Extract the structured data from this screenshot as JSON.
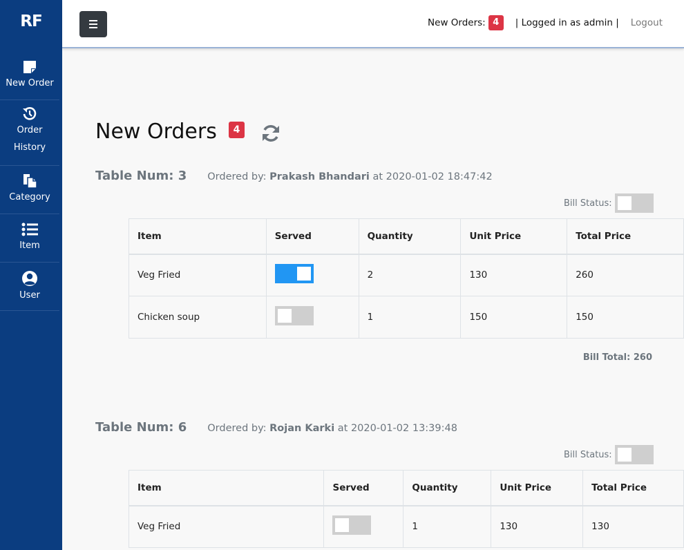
{
  "sidebar": {
    "logo": "RF",
    "items": [
      {
        "label": "New Order",
        "icon": "sticky-note-icon"
      },
      {
        "label": "Order History",
        "label_line1": "Order",
        "label_line2": "History",
        "icon": "history-icon"
      },
      {
        "label": "Category",
        "icon": "copy-icon"
      },
      {
        "label": "Item",
        "icon": "list-icon"
      },
      {
        "label": "User",
        "icon": "user-circle-icon"
      }
    ]
  },
  "topbar": {
    "new_orders_label": "New Orders:",
    "new_orders_count": "4",
    "logged_in": "| Logged in as admin |",
    "logout": "Logout"
  },
  "main": {
    "title": "New Orders",
    "count": "4"
  },
  "orders": [
    {
      "table_num": "Table Num: 3",
      "ordered_by_label": "Ordered by:",
      "customer": "Prakash Bhandari",
      "at_text": "at 2020-01-02 18:47:42",
      "bill_status_label": "Bill Status:",
      "bill_status_on": false,
      "columns": [
        "Item",
        "Served",
        "Quantity",
        "Unit Price",
        "Total Price"
      ],
      "rows": [
        {
          "item": "Veg Fried",
          "served": true,
          "quantity": "2",
          "unit_price": "130",
          "total_price": "260"
        },
        {
          "item": "Chicken soup",
          "served": false,
          "quantity": "1",
          "unit_price": "150",
          "total_price": "150"
        }
      ],
      "bill_total": "Bill Total: 260"
    },
    {
      "table_num": "Table Num: 6",
      "ordered_by_label": "Ordered by:",
      "customer": "Rojan Karki",
      "at_text": "at 2020-01-02 13:39:48",
      "bill_status_label": "Bill Status:",
      "bill_status_on": false,
      "columns": [
        "Item",
        "Served",
        "Quantity",
        "Unit Price",
        "Total Price"
      ],
      "rows": [
        {
          "item": "Veg Fried",
          "served": false,
          "quantity": "1",
          "unit_price": "130",
          "total_price": "130"
        }
      ]
    }
  ],
  "colors": {
    "sidebar": "#0b3d80",
    "badge": "#dc3545",
    "toggle_on": "#2196f3",
    "toggle_off": "#cfcfcf",
    "menu_button": "#343a40"
  }
}
